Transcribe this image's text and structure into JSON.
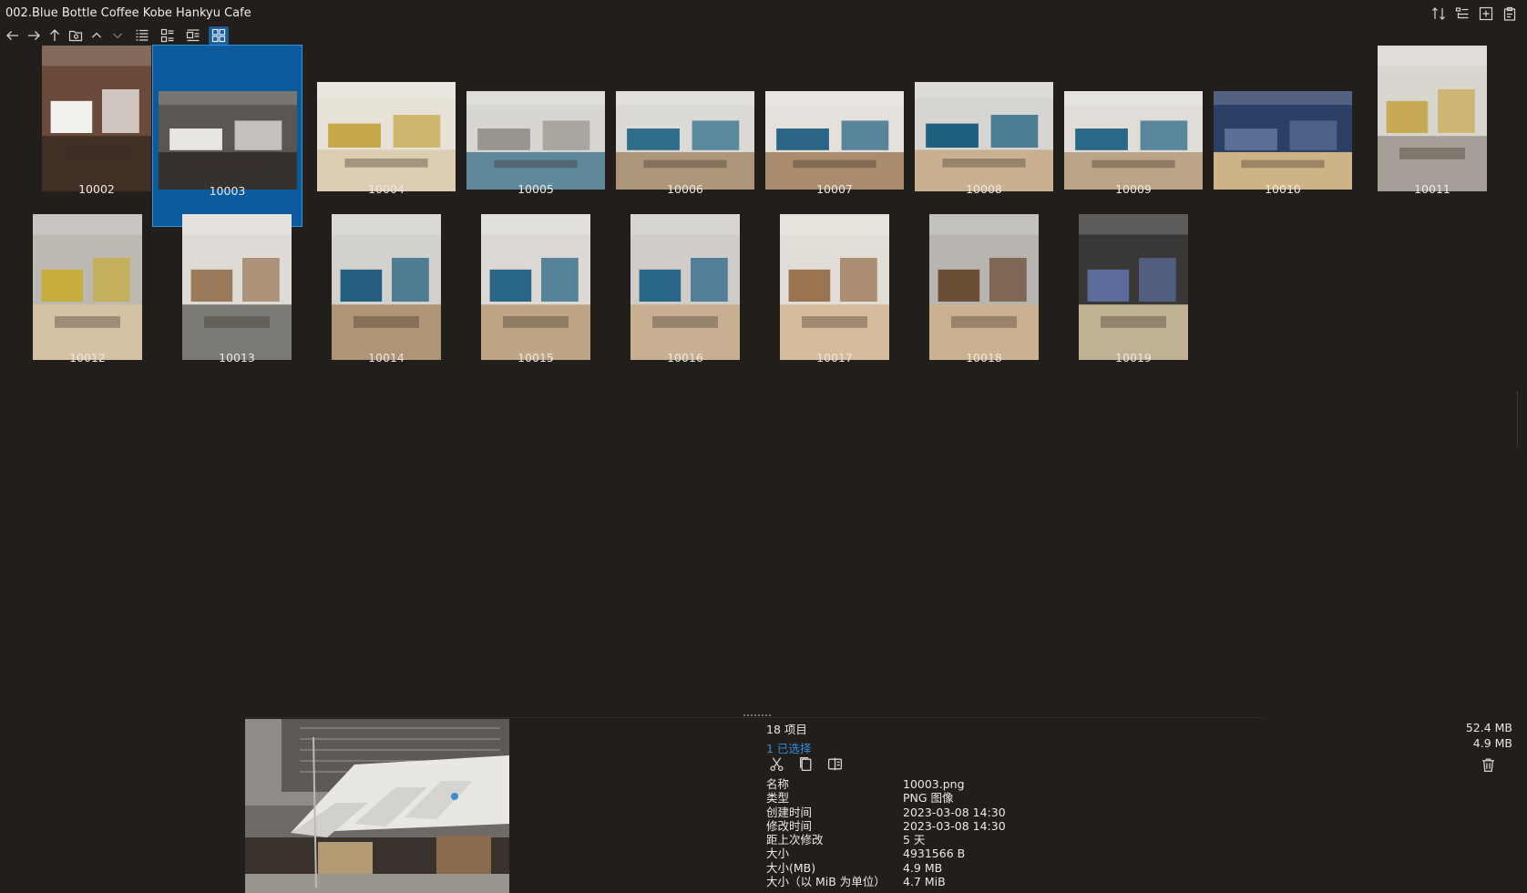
{
  "window": {
    "title": "002.Blue Bottle Coffee Kobe Hankyu Cafe",
    "top_icons": [
      "sort-icon",
      "details-pane-icon",
      "new-tab-icon",
      "clipboard-icon"
    ]
  },
  "toolbar": {
    "nav_icons": [
      "back-arrow-icon",
      "forward-arrow-icon",
      "up-arrow-icon",
      "folder-icon",
      "chevron-up-icon",
      "chevron-down-icon"
    ],
    "view_icons": [
      "list-view-icon",
      "details-view-icon",
      "tiles-view-icon",
      "thumbnails-view-icon"
    ],
    "active_view": "thumbnails-view-icon"
  },
  "files": [
    {
      "label": "10002",
      "palette": [
        "#6a4a3a",
        "#f2f0ec",
        "#3a2a22"
      ],
      "selected": false
    },
    {
      "label": "10003",
      "palette": [
        "#5a5652",
        "#e8e6e2",
        "#2e2a28"
      ],
      "selected": true
    },
    {
      "label": "10004",
      "palette": [
        "#e6e2d8",
        "#c7a84a",
        "#d9c8aa"
      ],
      "selected": false
    },
    {
      "label": "10005",
      "palette": [
        "#d8d6d2",
        "#9a968f",
        "#4a7a92"
      ],
      "selected": false
    },
    {
      "label": "10006",
      "palette": [
        "#dcdad6",
        "#2f6d8a",
        "#a58b6b"
      ],
      "selected": false
    },
    {
      "label": "10007",
      "palette": [
        "#e4e1dc",
        "#2a6585",
        "#a07d5a"
      ],
      "selected": false
    },
    {
      "label": "10008",
      "palette": [
        "#d7d5d1",
        "#1f5f80",
        "#c6a985"
      ],
      "selected": false
    },
    {
      "label": "10009",
      "palette": [
        "#e0ddd8",
        "#2b6888",
        "#b59a78"
      ],
      "selected": false
    },
    {
      "label": "10010",
      "palette": [
        "#2c3f66",
        "#5a6f96",
        "#e9c98c"
      ],
      "selected": false
    },
    {
      "label": "10011",
      "palette": [
        "#d9d6d0",
        "#c8aa55",
        "#9a948c"
      ],
      "selected": false
    },
    {
      "label": "10012",
      "palette": [
        "#bdb9b2",
        "#c7ad3d",
        "#d9c3a1"
      ],
      "selected": false
    },
    {
      "label": "10013",
      "palette": [
        "#dedbd6",
        "#9a7a5a",
        "#6b6864"
      ],
      "selected": false
    },
    {
      "label": "10014",
      "palette": [
        "#d3d1cd",
        "#245f80",
        "#a88a66"
      ],
      "selected": false
    },
    {
      "label": "10015",
      "palette": [
        "#dcd9d4",
        "#2a6686",
        "#b89b78"
      ],
      "selected": false
    },
    {
      "label": "10016",
      "palette": [
        "#d0cdc8",
        "#2a6688",
        "#c7a987"
      ],
      "selected": false
    },
    {
      "label": "10017",
      "palette": [
        "#e2ded7",
        "#9a7450",
        "#d1b592"
      ],
      "selected": false
    },
    {
      "label": "10018",
      "palette": [
        "#b8b5b0",
        "#6b4e36",
        "#cfb08c"
      ],
      "selected": false
    },
    {
      "label": "10019",
      "palette": [
        "#3a3836",
        "#5b6b9a",
        "#d8c7a4"
      ],
      "selected": false
    }
  ],
  "status": {
    "item_count": "18 项目",
    "selected_count": "1 已选择",
    "total_size": "52.4 MB",
    "selected_size": "4.9 MB"
  },
  "actions": [
    "scissors-icon",
    "copy-icon",
    "compare-icon"
  ],
  "properties": [
    {
      "key": "名称",
      "value": "10003.png"
    },
    {
      "key": "类型",
      "value": "PNG 图像"
    },
    {
      "key": "创建时间",
      "value": "2023-03-08  14:30"
    },
    {
      "key": "修改时间",
      "value": "2023-03-08  14:30"
    },
    {
      "key": "距上次修改",
      "value": "5 天"
    },
    {
      "key": "大小",
      "value": "4931566 B"
    },
    {
      "key": "大小(MB)",
      "value": "4.9 MB"
    },
    {
      "key": "大小（以 MiB 为单位）",
      "value": "4.7 MiB"
    }
  ],
  "colors": {
    "background": "#211e1c",
    "selection": "#0b5a9e",
    "accent": "#2e8fdc",
    "text": "#ece9e5"
  }
}
